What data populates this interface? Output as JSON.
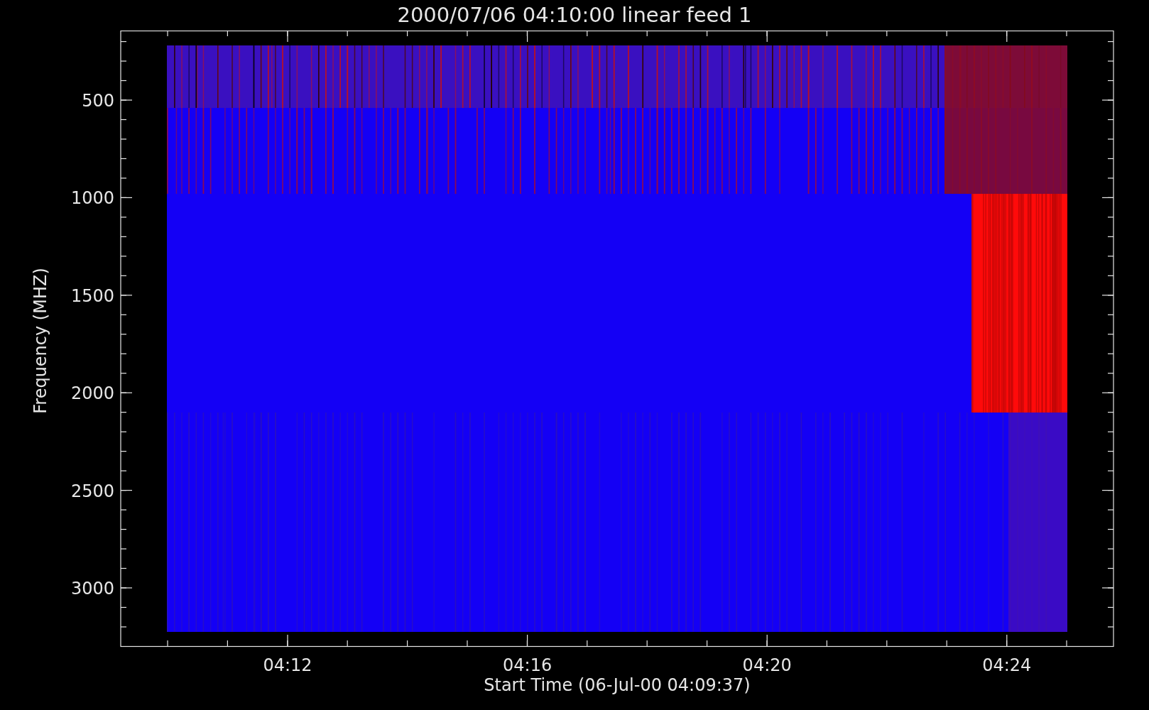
{
  "title": "2000/07/06 04:10:00 linear feed 1",
  "y_axis": {
    "label": "Frequency (MHZ)",
    "ticks": [
      "500",
      "1000",
      "1500",
      "2000",
      "2500",
      "3000"
    ]
  },
  "x_axis": {
    "label": "Start Time (06-Jul-00 04:09:37)",
    "ticks": [
      "04:12",
      "04:16",
      "04:20",
      "04:24"
    ]
  }
}
